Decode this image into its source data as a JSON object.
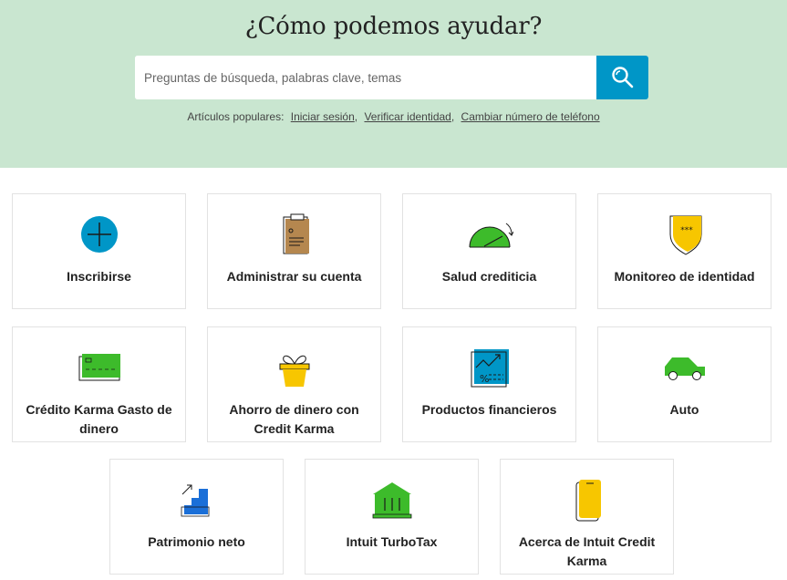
{
  "hero": {
    "title": "¿Cómo podemos ayudar?",
    "search_placeholder": "Preguntas de búsqueda, palabras clave, temas",
    "popular_label": "Artículos populares:",
    "popular_links": [
      "Iniciar sesión",
      "Verificar identidad",
      "Cambiar número de teléfono"
    ],
    "sep": ","
  },
  "cards": [
    {
      "label": "Inscribirse",
      "icon": "plus-circle-icon"
    },
    {
      "label": "Administrar su cuenta",
      "icon": "clipboard-icon"
    },
    {
      "label": "Salud crediticia",
      "icon": "gauge-icon"
    },
    {
      "label": "Monitoreo de identidad",
      "icon": "shield-icon"
    },
    {
      "label": "Crédito Karma Gasto de dinero",
      "icon": "card-icon"
    },
    {
      "label": "Ahorro de dinero con Credit Karma",
      "icon": "plant-pot-icon"
    },
    {
      "label": "Productos financieros",
      "icon": "chart-percent-icon"
    },
    {
      "label": "Auto",
      "icon": "car-icon"
    },
    {
      "label": "Patrimonio neto",
      "icon": "bar-growth-icon"
    },
    {
      "label": "Intuit TurboTax",
      "icon": "bank-icon"
    },
    {
      "label": "Acerca de Intuit Credit Karma",
      "icon": "phone-icon"
    }
  ],
  "colors": {
    "hero_bg": "#c9e6d0",
    "search_button": "#0096c7",
    "green": "#3dbb2b",
    "yellow": "#f7c600",
    "blue": "#0096c7"
  }
}
